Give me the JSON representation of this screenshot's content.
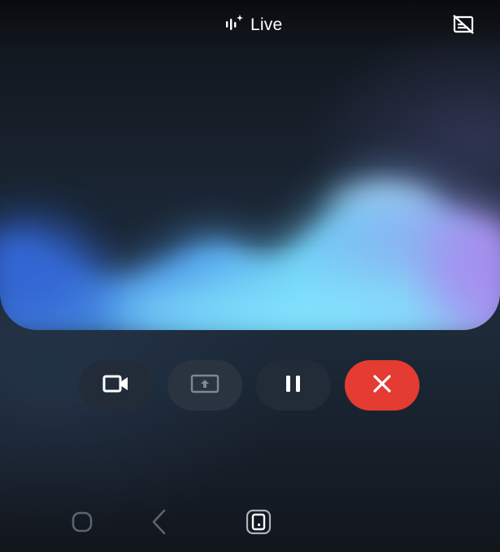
{
  "header": {
    "title": "Live",
    "title_icon": "sparkle-waveform-icon",
    "right_icon": "captions-off-icon"
  },
  "controls": [
    {
      "name": "camera-button",
      "icon": "video-camera-icon",
      "state": "enabled"
    },
    {
      "name": "share-screen-button",
      "icon": "screen-share-icon",
      "state": "disabled"
    },
    {
      "name": "pause-button",
      "icon": "pause-icon",
      "state": "enabled"
    },
    {
      "name": "end-call-button",
      "icon": "close-icon",
      "state": "enabled",
      "color": "#e43b32"
    }
  ],
  "nav": [
    {
      "name": "nav-home-button",
      "icon": "home-rounded-square-icon"
    },
    {
      "name": "nav-back-button",
      "icon": "back-chevron-icon"
    },
    {
      "name": "nav-recents-button",
      "icon": "recents-phone-icon"
    }
  ],
  "colors": {
    "end_call": "#e43b32",
    "wave_light": "#7fe6ff",
    "wave_blue": "#3f7fe0",
    "wave_purple": "#a98ff0"
  }
}
